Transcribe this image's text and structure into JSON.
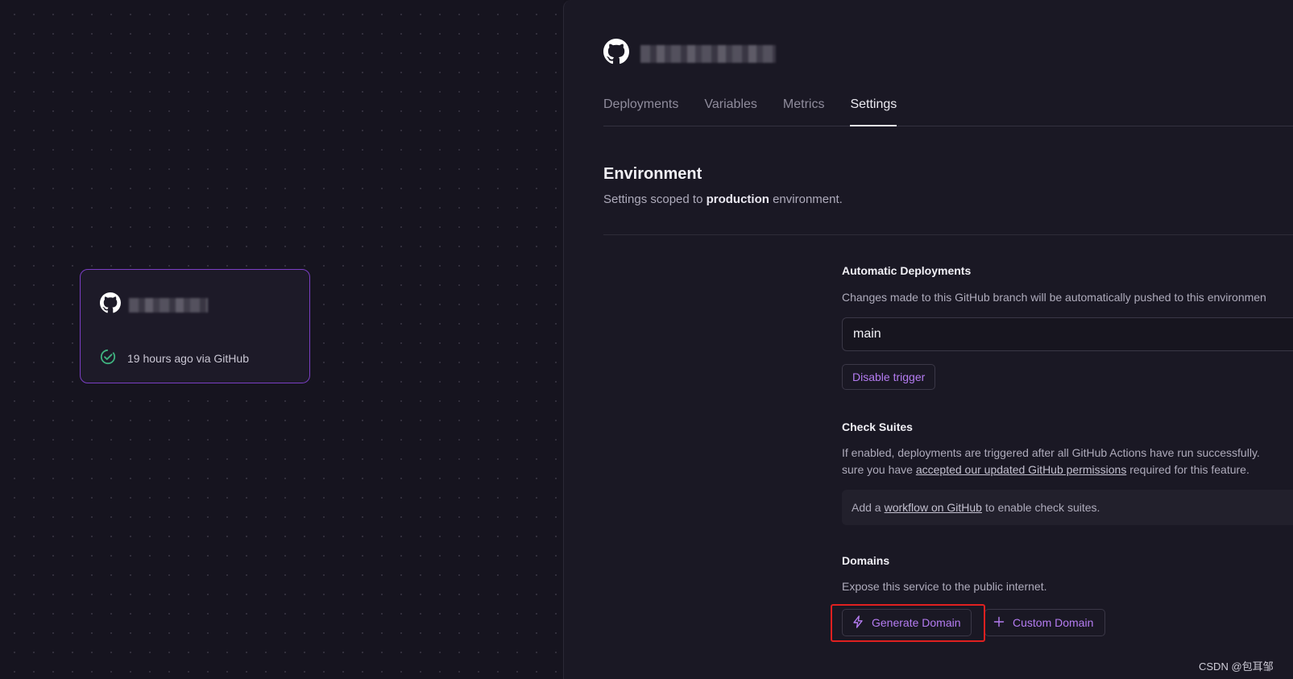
{
  "card": {
    "icon": "github-icon",
    "status_icon": "check-circle-icon",
    "status_text": "19 hours ago via GitHub"
  },
  "panel": {
    "icon": "github-icon",
    "tabs": [
      {
        "label": "Deployments"
      },
      {
        "label": "Variables"
      },
      {
        "label": "Metrics"
      },
      {
        "label": "Settings",
        "active": true
      }
    ]
  },
  "environment": {
    "title": "Environment",
    "sub_prefix": "Settings scoped to ",
    "sub_bold": "production",
    "sub_suffix": " environment."
  },
  "auto_deploy": {
    "title": "Automatic Deployments",
    "text": "Changes made to this GitHub branch will be automatically pushed to this environmen",
    "branch_value": "main",
    "disable_label": "Disable trigger"
  },
  "check_suites": {
    "title": "Check Suites",
    "text_line1": "If enabled, deployments are triggered after all GitHub Actions have run successfully.",
    "text_line2_prefix": "sure you have ",
    "text_line2_link": "accepted our updated GitHub permissions",
    "text_line2_suffix": " required for this feature.",
    "box_prefix": "Add a",
    "box_link": "workflow on GitHub",
    "box_suffix": "to enable check suites."
  },
  "domains": {
    "title": "Domains",
    "text": "Expose this service to the public internet.",
    "generate_label": "Generate Domain",
    "custom_label": "Custom Domain"
  },
  "watermark": "CSDN @包耳邹",
  "colors": {
    "accent": "#b57cf2",
    "card_border": "#7b3fc4",
    "success": "#3fb27f",
    "highlight": "#e02020"
  }
}
